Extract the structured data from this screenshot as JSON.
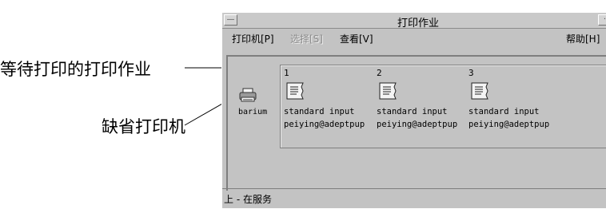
{
  "callouts": {
    "jobs_label": "等待打印的打印作业",
    "default_printer_label": "缺省打印机"
  },
  "window": {
    "title": "打印作业",
    "menu": {
      "printer": "打印机[P]",
      "select": "选择[S]",
      "view": "查看[V]",
      "help": "帮助[H]"
    },
    "printer": {
      "name": "barium",
      "icon": "printer-icon"
    },
    "jobs": [
      {
        "number": "1",
        "name": "standard input",
        "owner": "peiying@adeptpup",
        "icon": "document-icon"
      },
      {
        "number": "2",
        "name": "standard input",
        "owner": "peiying@adeptpup",
        "icon": "document-icon"
      },
      {
        "number": "3",
        "name": "standard input",
        "owner": "peiying@adeptpup",
        "icon": "document-icon"
      }
    ],
    "status": "上 - 在服务"
  }
}
